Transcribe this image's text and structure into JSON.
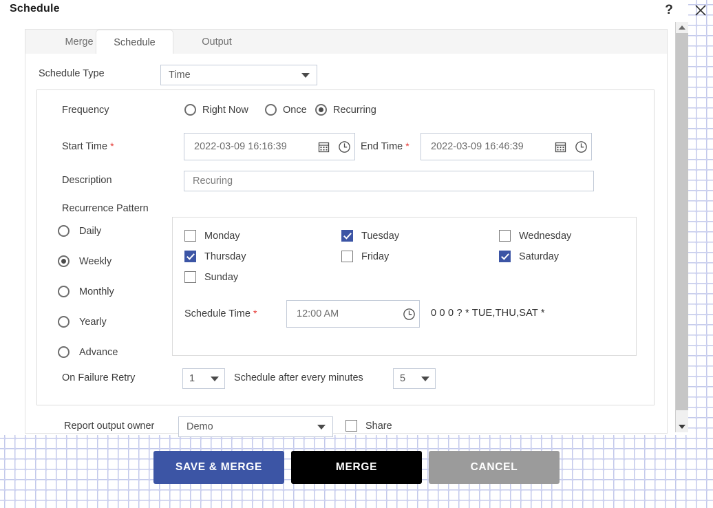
{
  "window": {
    "title": "Schedule",
    "help_icon": "question-mark-icon",
    "close_icon": "close-icon"
  },
  "tabs": [
    {
      "id": "merge",
      "label": "Merge",
      "active": false
    },
    {
      "id": "schedule",
      "label": "Schedule",
      "active": true
    },
    {
      "id": "output",
      "label": "Output",
      "active": false
    }
  ],
  "schedule_type": {
    "label": "Schedule Type",
    "value": "Time"
  },
  "frequency": {
    "label": "Frequency",
    "options": [
      {
        "label": "Right Now",
        "selected": false
      },
      {
        "label": "Once",
        "selected": false
      },
      {
        "label": "Recurring",
        "selected": true
      }
    ]
  },
  "start_time": {
    "label": "Start Time",
    "required_marker": "*",
    "value": "2022-03-09 16:16:39",
    "calendar_icon": "calendar-icon",
    "clock_icon": "clock-icon"
  },
  "end_time": {
    "label": "End Time",
    "required_marker": "*",
    "value": "2022-03-09 16:46:39",
    "calendar_icon": "calendar-icon",
    "clock_icon": "clock-icon"
  },
  "description": {
    "label": "Description",
    "value": "Recuring",
    "placeholder": "Recuring"
  },
  "recurrence_pattern": {
    "label": "Recurrence Pattern",
    "options": [
      {
        "label": "Daily",
        "selected": false
      },
      {
        "label": "Weekly",
        "selected": true
      },
      {
        "label": "Monthly",
        "selected": false
      },
      {
        "label": "Yearly",
        "selected": false
      },
      {
        "label": "Advance",
        "selected": false
      }
    ]
  },
  "days": [
    {
      "label": "Monday",
      "checked": false
    },
    {
      "label": "Tuesday",
      "checked": true
    },
    {
      "label": "Wednesday",
      "checked": false
    },
    {
      "label": "Thursday",
      "checked": true
    },
    {
      "label": "Friday",
      "checked": false
    },
    {
      "label": "Saturday",
      "checked": true
    },
    {
      "label": "Sunday",
      "checked": false
    }
  ],
  "schedule_time": {
    "label": "Schedule Time",
    "required_marker": "*",
    "value": "12:00 AM",
    "clock_icon": "clock-icon",
    "cron_expression": "0 0 0 ? * TUE,THU,SAT *"
  },
  "on_failure_retry": {
    "label": "On Failure Retry",
    "value": "1"
  },
  "schedule_after": {
    "label": "Schedule after every minutes",
    "value": "5"
  },
  "report_output_owner": {
    "label": "Report output owner",
    "value": "Demo"
  },
  "share": {
    "label": "Share",
    "checked": false
  },
  "actions": {
    "save_merge": "SAVE & MERGE",
    "merge": "MERGE",
    "cancel": "CANCEL"
  },
  "scrollbar": {
    "up_icon": "chevron-up-icon",
    "down_icon": "chevron-down-icon"
  },
  "colors": {
    "accent_blue": "#3c55a5",
    "merge_black": "#000000",
    "cancel_gray": "#9b9b9b",
    "required_red": "#e53935"
  }
}
